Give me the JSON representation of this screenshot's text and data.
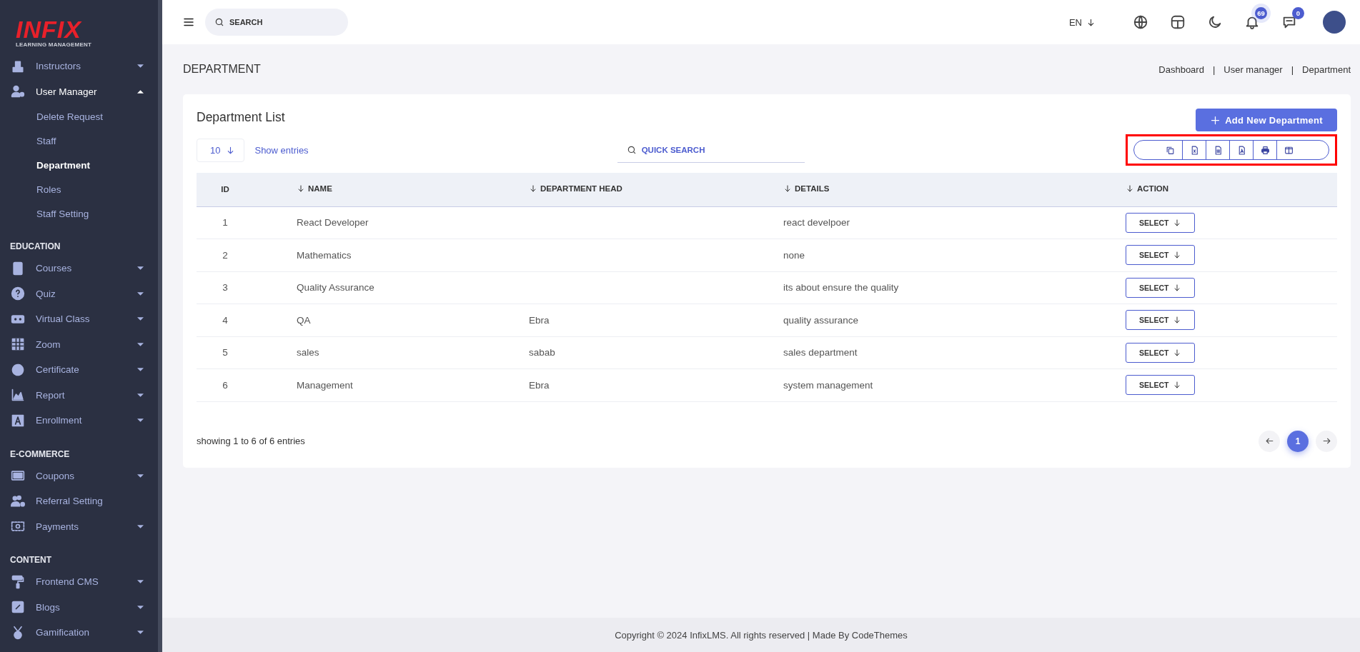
{
  "sidebar": {
    "logo": {
      "title": "INFIX",
      "subtitle": "LEARNING MANAGEMENT"
    },
    "sections": [
      {
        "items": [
          {
            "label": "Instructors",
            "has_submenu": true,
            "expanded": false
          },
          {
            "label": "User Manager",
            "has_submenu": true,
            "expanded": true,
            "children": [
              {
                "label": "Delete Request",
                "selected": false
              },
              {
                "label": "Staff",
                "selected": false
              },
              {
                "label": "Department",
                "selected": true
              },
              {
                "label": "Roles",
                "selected": false
              },
              {
                "label": "Staff Setting",
                "selected": false
              }
            ]
          }
        ]
      },
      {
        "heading": "EDUCATION",
        "items": [
          {
            "label": "Courses",
            "has_submenu": true,
            "expanded": false
          },
          {
            "label": "Quiz",
            "has_submenu": true,
            "expanded": false
          },
          {
            "label": "Virtual Class",
            "has_submenu": true,
            "expanded": false
          },
          {
            "label": "Zoom",
            "has_submenu": true,
            "expanded": false
          },
          {
            "label": "Certificate",
            "has_submenu": true,
            "expanded": false
          },
          {
            "label": "Report",
            "has_submenu": true,
            "expanded": false
          },
          {
            "label": "Enrollment",
            "has_submenu": true,
            "expanded": false
          }
        ]
      },
      {
        "heading": "E-COMMERCE",
        "items": [
          {
            "label": "Coupons",
            "has_submenu": true,
            "expanded": false
          },
          {
            "label": "Referral Setting",
            "has_submenu": false,
            "expanded": false
          },
          {
            "label": "Payments",
            "has_submenu": true,
            "expanded": false
          }
        ]
      },
      {
        "heading": "CONTENT",
        "items": [
          {
            "label": "Frontend CMS",
            "has_submenu": true,
            "expanded": false
          },
          {
            "label": "Blogs",
            "has_submenu": true,
            "expanded": false
          },
          {
            "label": "Gamification",
            "has_submenu": true,
            "expanded": false
          }
        ]
      }
    ]
  },
  "topbar": {
    "search": {
      "placeholder": "SEARCH"
    },
    "language": "EN",
    "notifications": "69",
    "messages": "0"
  },
  "page": {
    "title": "DEPARTMENT",
    "breadcrumb": [
      "Dashboard",
      "User manager",
      "Department"
    ],
    "breadcrumb_separator": "|"
  },
  "card": {
    "title": "Department List",
    "add_button": "Add New Department",
    "page_size": "10",
    "show_entries": "Show entries",
    "search": {
      "placeholder": "QUICK SEARCH"
    },
    "export_toolbar": {
      "highlighted": true
    },
    "table": {
      "columns": [
        {
          "label": "ID",
          "sortable": false
        },
        {
          "label": "NAME",
          "sortable": true
        },
        {
          "label": "DEPARTMENT HEAD",
          "sortable": true
        },
        {
          "label": "DETAILS",
          "sortable": true
        },
        {
          "label": "ACTION",
          "sortable": true
        }
      ],
      "rows": [
        {
          "id": "1",
          "name": "React Developer",
          "head": "",
          "details": "react develpoer",
          "action": "SELECT"
        },
        {
          "id": "2",
          "name": "Mathematics",
          "head": "",
          "details": "none",
          "action": "SELECT"
        },
        {
          "id": "3",
          "name": "Quality Assurance",
          "head": "",
          "details": "its about ensure the quality",
          "action": "SELECT"
        },
        {
          "id": "4",
          "name": "QA",
          "head": "Ebra",
          "details": "quality assurance",
          "action": "SELECT"
        },
        {
          "id": "5",
          "name": "sales",
          "head": "sabab",
          "details": "sales department",
          "action": "SELECT"
        },
        {
          "id": "6",
          "name": "Management",
          "head": "Ebra",
          "details": "system management",
          "action": "SELECT"
        }
      ]
    },
    "summary": "showing 1 to 6 of 6 entries",
    "pagination": [
      {
        "label": "1",
        "selected": true
      }
    ]
  },
  "footer": "Copyright © 2024 InfixLMS. All rights reserved | Made By CodeThemes"
}
